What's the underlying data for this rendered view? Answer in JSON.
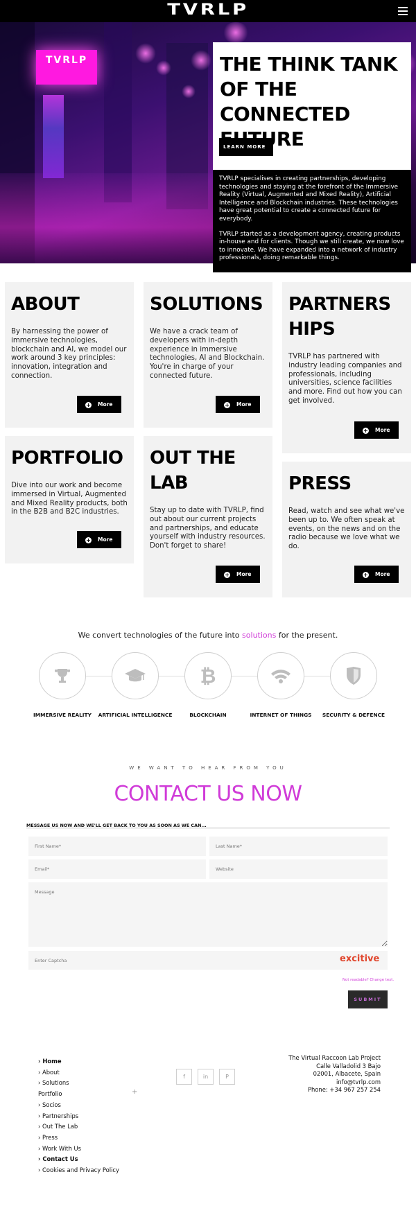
{
  "header": {
    "logo": "TVRLP",
    "menu_icon": "hamburger-icon"
  },
  "hero": {
    "sign_text": "TVRLP",
    "title": "THE THINK TANK OF THE CONNECTED FUTURE",
    "cta": "LEARN MORE",
    "paragraphs": [
      "TVRLP specialises in creating partnerships, developing technologies and staying at the forefront of the Immersive Reality (Virtual, Augmented and Mixed Reality), Artificial Intelligence and Blockchain industries. These technologies have great potential to create a connected future for everybody.",
      "TVRLP started as a development agency, creating products in-house and for clients. Though we still create, we now love to innovate. We have expanded into a network of industry professionals, doing remarkable things."
    ]
  },
  "cards": [
    {
      "title": "ABOUT",
      "text": "By harnessing the power of immersive technologies, blockchain and AI, we model our work around 3 key principles: innovation, integration and connection.",
      "button": "More"
    },
    {
      "title": "SOLUTIONS",
      "text": "We have a crack team of developers with in-depth experience in immersive technologies, AI and Blockchain. You're in charge of your connected future.",
      "button": "More"
    },
    {
      "title": "PARTNERSHIPS",
      "text": "TVRLP has partnered with industry leading companies and professionals, including universities, science facilities and more. Find out how you can get involved.",
      "button": "More"
    },
    {
      "title": "PORTFOLIO",
      "text": "Dive into our work and become immersed in Virtual, Augmented and Mixed Reality products, both in the B2B and B2C industries.",
      "button": "More"
    },
    {
      "title": "OUT THE LAB",
      "text": "Stay up to date with TVRLP, find out about our current projects and partnerships, and educate yourself with industry resources. Don't forget to share!",
      "button": "More"
    },
    {
      "title": "PRESS",
      "text": "Read, watch and see what we've been up to. We often speak at events, on the news and on the radio because we love what we do.",
      "button": "More"
    }
  ],
  "tech": {
    "line_before": "We convert technologies of the future into ",
    "line_accent": "solutions",
    "line_after": " for the present.",
    "items": [
      {
        "label": "IMMERSIVE REALITY",
        "icon": "trophy-icon"
      },
      {
        "label": "ARTIFICIAL INTELLIGENCE",
        "icon": "graduation-cap-icon"
      },
      {
        "label": "BLOCKCHAIN",
        "icon": "bitcoin-icon"
      },
      {
        "label": "INTERNET OF THINGS",
        "icon": "wifi-icon"
      },
      {
        "label": "SECURITY & DEFENCE",
        "icon": "shield-icon"
      }
    ]
  },
  "contact": {
    "kicker": "WE WANT TO HEAR FROM YOU",
    "title": "CONTACT US NOW",
    "note": "MESSAGE US NOW AND WE'LL GET BACK TO YOU AS SOON AS WE CAN...",
    "placeholders": {
      "first_name": "First Name*",
      "last_name": "Last Name*",
      "email": "Email*",
      "website": "Website",
      "message": "Message",
      "captcha": "Enter Captcha"
    },
    "captcha_image_text": "excitive",
    "change_text": "Not readable? Change text.",
    "submit": "SUBMIT"
  },
  "footer": {
    "nav": [
      {
        "label": "› Home",
        "bold": true
      },
      {
        "label": "› About",
        "bold": false
      },
      {
        "label": "› Solutions",
        "bold": false
      },
      {
        "label": "Portfolio",
        "bold": false
      },
      {
        "label": "› Socios",
        "bold": false
      },
      {
        "label": "› Partnerships",
        "bold": false
      },
      {
        "label": "› Out The Lab",
        "bold": false
      },
      {
        "label": "› Press",
        "bold": false
      },
      {
        "label": "› Work With Us",
        "bold": false
      },
      {
        "label": "› Contact Us",
        "bold": true
      },
      {
        "label": "› Cookies and Privacy Policy",
        "bold": false
      }
    ],
    "portfolio_toggle": "+",
    "social": [
      {
        "glyph": "f",
        "icon": "facebook-icon"
      },
      {
        "glyph": "in",
        "icon": "linkedin-icon"
      },
      {
        "glyph": "P",
        "icon": "pinterest-icon"
      }
    ],
    "address": [
      "The Virtual Raccoon Lab Project",
      "Calle Valladolid 3 Bajo",
      "02001, Albacete, Spain",
      "info@tvrlp.com",
      "Phone: +34 967 257 254"
    ]
  }
}
